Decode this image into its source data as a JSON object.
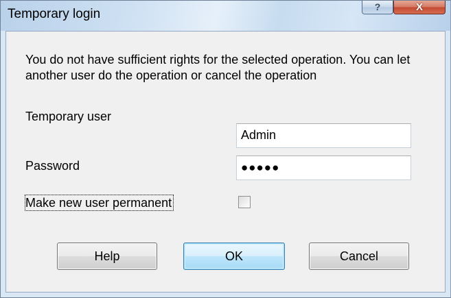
{
  "window": {
    "title": "Temporary login",
    "help_glyph": "?",
    "close_glyph": "X"
  },
  "message": "You do not have sufficient rights for the selected operation. You can let another user do the operation or cancel the operation",
  "form": {
    "user_label": "Temporary user",
    "user_value": "Admin",
    "password_label": "Password",
    "password_mask": "●●●●●",
    "permanent_label": "Make new user permanent",
    "permanent_checked": false
  },
  "buttons": {
    "help": "Help",
    "ok": "OK",
    "cancel": "Cancel"
  },
  "colors": {
    "titlebar": "#cfe1f3",
    "client_bg": "#f0f0f0",
    "close_button": "#c34b33",
    "default_button": "#bee6fd"
  }
}
